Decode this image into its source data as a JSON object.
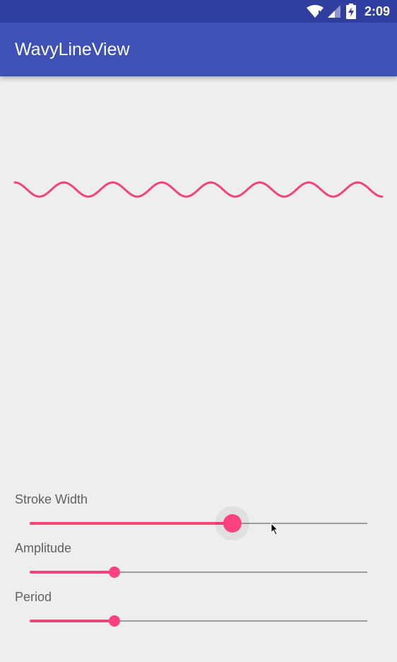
{
  "status_bar": {
    "time": "2:09"
  },
  "app_bar": {
    "title": "WavyLineView"
  },
  "wave": {
    "color": "#f0437a",
    "periods": 7.5
  },
  "controls": {
    "stroke_width": {
      "label": "Stroke Width",
      "value_fraction": 0.6
    },
    "amplitude": {
      "label": "Amplitude",
      "value_fraction": 0.25
    },
    "period": {
      "label": "Period",
      "value_fraction": 0.25
    }
  },
  "colors": {
    "primary": "#3f51b5",
    "primary_dark": "#303f9f",
    "accent": "#ff4081",
    "background": "#eeeeee"
  }
}
